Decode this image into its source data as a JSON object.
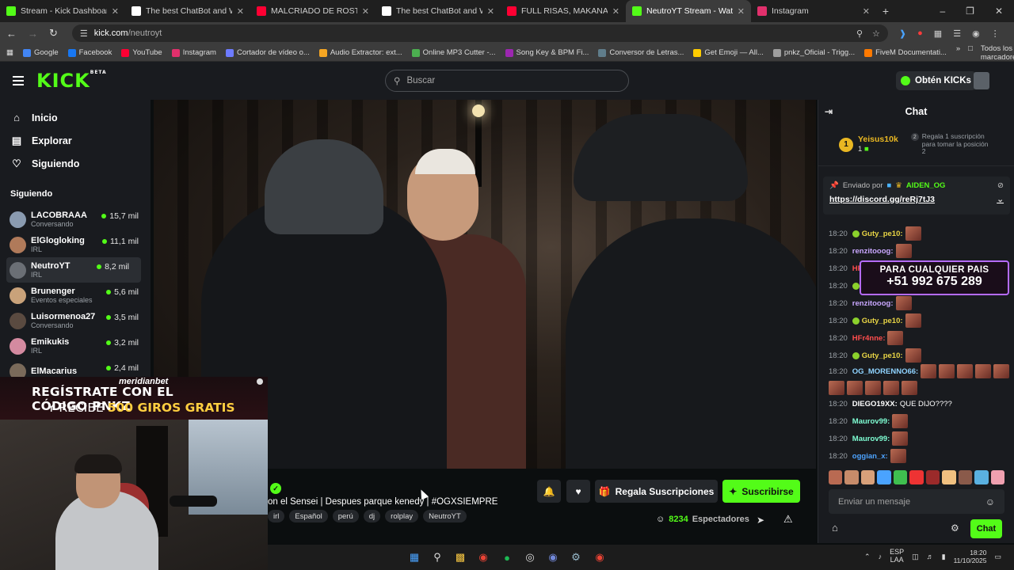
{
  "browser": {
    "tabs": [
      {
        "title": "Stream - Kick Dashboard",
        "icon": "kick-icon",
        "color": "#53fc18"
      },
      {
        "title": "The best ChatBot and Widgets",
        "icon": "diamond-icon",
        "color": "#ffffff"
      },
      {
        "title": "MALCRIADO DE ROSTRO ft. PN",
        "icon": "youtube-icon",
        "color": "#ff0033"
      },
      {
        "title": "The best ChatBot and Widgets",
        "icon": "diamond-icon",
        "color": "#ffffff"
      },
      {
        "title": "FULL RISAS, MAKANAKY Y",
        "icon": "youtube-icon",
        "color": "#ff0033"
      },
      {
        "title": "NeutroYT Stream - Watch L",
        "icon": "kick-icon",
        "color": "#53fc18"
      },
      {
        "title": "Instagram",
        "icon": "instagram-icon",
        "color": "#e1306c"
      }
    ],
    "url_host": "kick.com",
    "url_path": "/neutroyt",
    "bookmarks": [
      {
        "label": "Google",
        "color": "#4285f4"
      },
      {
        "label": "Facebook",
        "color": "#1877f2"
      },
      {
        "label": "YouTube",
        "color": "#ff0033"
      },
      {
        "label": "Instagram",
        "color": "#e1306c"
      },
      {
        "label": "Cortador de vídeo o...",
        "color": "#6d7bff"
      },
      {
        "label": "Audio Extractor: ext...",
        "color": "#f5a623"
      },
      {
        "label": "Online MP3 Cutter -...",
        "color": "#4caf50"
      },
      {
        "label": "Song Key & BPM Fi...",
        "color": "#9c27b0"
      },
      {
        "label": "Conversor de Letras...",
        "color": "#607d8b"
      },
      {
        "label": "Get Emoji — All...",
        "color": "#ffcc00"
      },
      {
        "label": "pnkz_Oficial - Trigg...",
        "color": "#9e9e9e"
      },
      {
        "label": "FiveM Documentati...",
        "color": "#ff7a00"
      }
    ],
    "all_bookmarks": "Todos los marcadores"
  },
  "kick": {
    "logo": "KICK",
    "logo_sup": "BETA",
    "search_placeholder": "Buscar",
    "get_kicks": "Obtén KICKs",
    "nav": [
      {
        "label": "Inicio",
        "icon": "home-icon"
      },
      {
        "label": "Explorar",
        "icon": "compass-icon"
      },
      {
        "label": "Siguiendo",
        "icon": "heart-icon"
      }
    ],
    "following_title": "Siguiendo",
    "following": [
      {
        "name": "LACOBRAAA",
        "category": "Conversando",
        "viewers": "15,7 mil",
        "color": "#8a9bb0"
      },
      {
        "name": "ElGlogloking",
        "category": "IRL",
        "viewers": "11,1 mil",
        "color": "#b07a5a"
      },
      {
        "name": "NeutroYT",
        "category": "IRL",
        "viewers": "8,2 mil",
        "color": "#6b6f75"
      },
      {
        "name": "Brunenger",
        "category": "Eventos especiales",
        "viewers": "5,6 mil",
        "color": "#c9a27a"
      },
      {
        "name": "Luisormenoa27",
        "category": "Conversando",
        "viewers": "3,5 mil",
        "color": "#5a4a40"
      },
      {
        "name": "Emikukis",
        "category": "IRL",
        "viewers": "3,2 mil",
        "color": "#d48aa0"
      },
      {
        "name": "ElMacarius",
        "category": "",
        "viewers": "2,4 mil",
        "color": "#7a6a5a"
      }
    ]
  },
  "promo": {
    "brand": "meridianbet",
    "line1": "REGÍSTRATE CON EL CÓDIGO",
    "code": "PNKZ",
    "line2_pre": "Y RECIBE",
    "line2_hl": "500 GIROS GRATIS"
  },
  "stream": {
    "title": "on el Sensei | Despues parque kenedy | #OGXSIEMPRE",
    "tags": [
      "irl",
      "Español",
      "perú",
      "dj",
      "rolplay",
      "NeutroYT"
    ],
    "gift_label": "Regala Suscripciones",
    "subscribe_label": "Suscribirse",
    "viewers": "8234",
    "viewers_label": "Espectadores"
  },
  "chat": {
    "title": "Chat",
    "leader_rank": "1",
    "leader_name": "Yeisus10k",
    "leader_count": "1",
    "slot_text": "Regala 1 suscripción para tomar la posición 2",
    "slot_num": "2",
    "pinned_by": "Enviado por",
    "pinned_user": "AIDEN_OG",
    "pinned_link": "https://discord.gg/reRj7tJ3",
    "messages": [
      {
        "time": "18:20",
        "user": "Guty_pe10:",
        "color": "#e9d545",
        "text": "",
        "emotes": 1,
        "badge": true
      },
      {
        "time": "18:20",
        "user": "renzitooog:",
        "color": "#c9a7ff",
        "text": "",
        "emotes": 1,
        "badge": false
      },
      {
        "time": "18:20",
        "user": "HF",
        "color": "#ff4d4d",
        "text": "",
        "emotes": 0,
        "badge": false
      },
      {
        "time": "18:20",
        "user": "",
        "color": "#e9d545",
        "text": "",
        "emotes": 0,
        "badge": true
      },
      {
        "time": "18:20",
        "user": "renzitooog:",
        "color": "#c9a7ff",
        "text": "",
        "emotes": 1,
        "badge": false
      },
      {
        "time": "18:20",
        "user": "Guty_pe10:",
        "color": "#e9d545",
        "text": "",
        "emotes": 1,
        "badge": true
      },
      {
        "time": "18:20",
        "user": "HFr4nne:",
        "color": "#ff4d4d",
        "text": "",
        "emotes": 1,
        "badge": false
      },
      {
        "time": "18:20",
        "user": "Guty_pe10:",
        "color": "#e9d545",
        "text": "",
        "emotes": 1,
        "badge": true
      },
      {
        "time": "18:20",
        "user": "OG_MORENNO66:",
        "color": "#8fd3ff",
        "text": "",
        "emotes": 10,
        "badge": false
      },
      {
        "time": "18:20",
        "user": "DIEGO19XX:",
        "color": "#ffffff",
        "text": "QUE DIJO????",
        "emotes": 0,
        "badge": false
      },
      {
        "time": "18:20",
        "user": "Maurov99:",
        "color": "#7fffd4",
        "text": "",
        "emotes": 1,
        "badge": false
      },
      {
        "time": "18:20",
        "user": "Maurov99:",
        "color": "#7fffd4",
        "text": "",
        "emotes": 1,
        "badge": false
      },
      {
        "time": "18:20",
        "user": "oggian_x:",
        "color": "#4da3ff",
        "text": "",
        "emotes": 1,
        "badge": false
      }
    ],
    "promo_line1": "PARA CUALQUIER PAIS",
    "promo_line2": "+51 992 675 289",
    "input_placeholder": "Enviar un mensaje",
    "send_label": "Chat"
  },
  "taskbar": {
    "lang1": "ESP",
    "lang2": "LAA",
    "time": "18:20",
    "date": "11/10/2025"
  }
}
